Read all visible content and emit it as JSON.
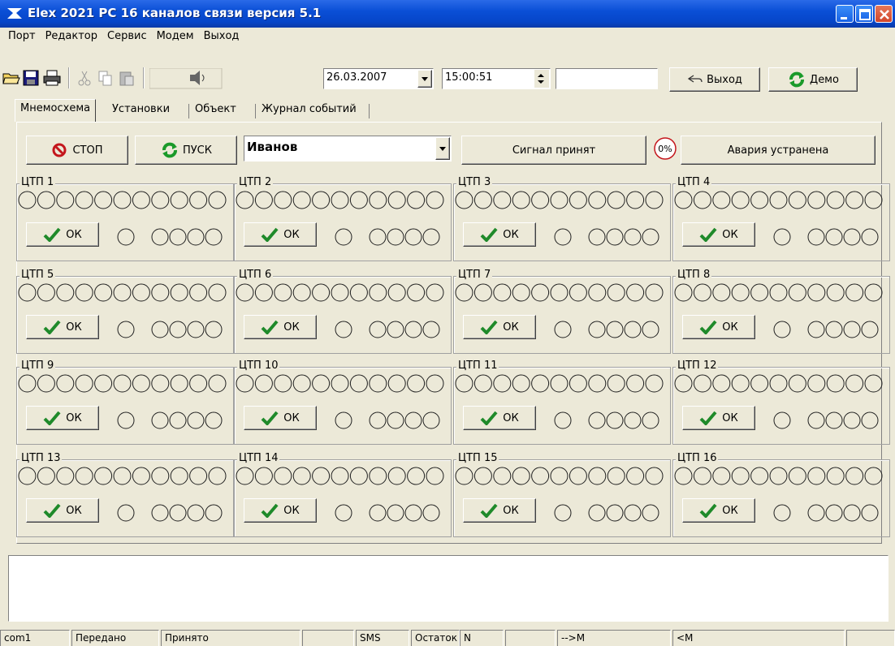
{
  "window": {
    "title": "Elex 2021 PC  16 каналов связи   версия 5.1"
  },
  "menu": [
    "Порт",
    "Редактор",
    "Сервис",
    "Модем",
    "Выход"
  ],
  "toolbar": {
    "date": "26.03.2007",
    "time": "15:00:51",
    "extra_field": "",
    "exit_label": "Выход",
    "demo_label": "Демо"
  },
  "tabs": [
    "Мнемосхема",
    "Установки",
    "Объект",
    "Журнал событий"
  ],
  "controls": {
    "stop_label": "СТОП",
    "start_label": "ПУСК",
    "operator": "Иванов",
    "signal_ack_label": "Сигнал принят",
    "percent": "0%",
    "fault_cleared_label": "Авария устранена"
  },
  "channels": [
    {
      "name": "ЦТП 1",
      "ok": "ОК"
    },
    {
      "name": "ЦТП 2",
      "ok": "ОК"
    },
    {
      "name": "ЦТП 3",
      "ok": "ОК"
    },
    {
      "name": "ЦТП 4",
      "ok": "ОК"
    },
    {
      "name": "ЦТП 5",
      "ok": "ОК"
    },
    {
      "name": "ЦТП 6",
      "ok": "ОК"
    },
    {
      "name": "ЦТП 7",
      "ok": "ОК"
    },
    {
      "name": "ЦТП 8",
      "ok": "ОК"
    },
    {
      "name": "ЦТП 9",
      "ok": "ОК"
    },
    {
      "name": "ЦТП 10",
      "ok": "ОК"
    },
    {
      "name": "ЦТП 11",
      "ok": "ОК"
    },
    {
      "name": "ЦТП 12",
      "ok": "ОК"
    },
    {
      "name": "ЦТП 13",
      "ok": "ОК"
    },
    {
      "name": "ЦТП 14",
      "ok": "ОК"
    },
    {
      "name": "ЦТП 15",
      "ok": "ОК"
    },
    {
      "name": "ЦТП 16",
      "ok": "ОК"
    }
  ],
  "log": "",
  "status": [
    "com1",
    "Передано",
    "Принято",
    "",
    "SMS",
    "Остаток",
    "N",
    "",
    "-->M",
    "<M",
    ""
  ]
}
